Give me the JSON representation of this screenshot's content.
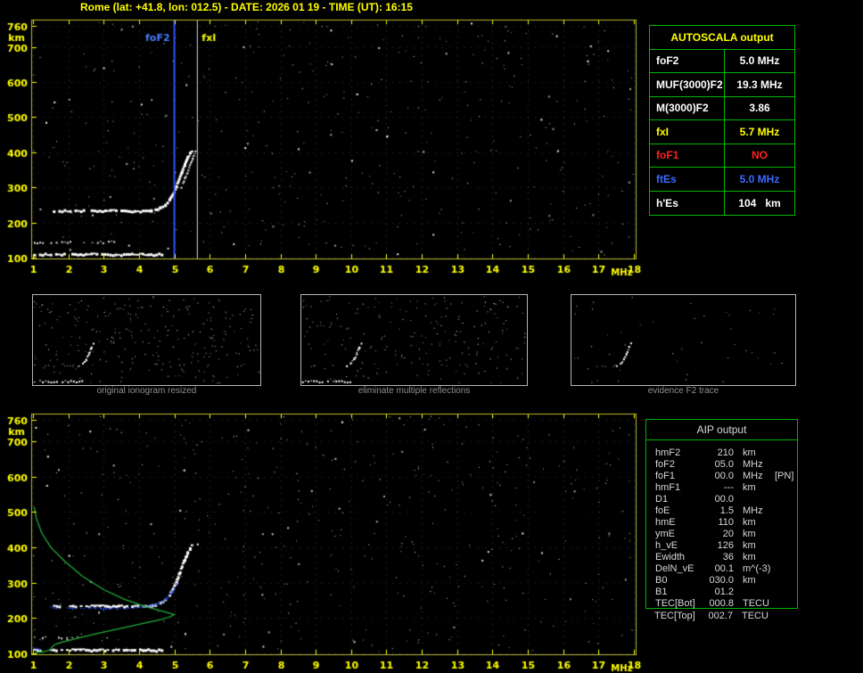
{
  "header": {
    "title": "Rome (lat: +41.8, lon: 012.5) - DATE: 2026 01 19 - TIME (UT): 16:15",
    "color": "#ffff00"
  },
  "autoscala": {
    "title": "AUTOSCALA output",
    "title_color": "#ffff00",
    "border_color": "#00b400",
    "rows": [
      {
        "label": "foF2",
        "value": "5.0 MHz",
        "color": "#ffffff"
      },
      {
        "label": "MUF(3000)F2",
        "value": "19.3 MHz",
        "color": "#ffffff"
      },
      {
        "label": "M(3000)F2",
        "value": "3.86",
        "color": "#ffffff"
      },
      {
        "label": "fxI",
        "value": "5.7 MHz",
        "color": "#ffff00"
      },
      {
        "label": "foF1",
        "value": "NO",
        "color": "#ff2020"
      },
      {
        "label": "ftEs",
        "value": "5.0 MHz",
        "color": "#3a6bff"
      },
      {
        "label": "h'Es",
        "value": "104   km",
        "color": "#ffffff"
      }
    ]
  },
  "thumbnails": [
    {
      "caption": "original ionogram resized"
    },
    {
      "caption": "eliminate multiple reflections"
    },
    {
      "caption": "evidence F2 trace"
    }
  ],
  "aip": {
    "title": "AIP output",
    "border_color": "#00b400",
    "text_color": "#d8d8d8",
    "rows": [
      {
        "name": "hmF2",
        "value": "210",
        "unit": "km",
        "extra": ""
      },
      {
        "name": "foF2",
        "value": "05.0",
        "unit": "MHz",
        "extra": ""
      },
      {
        "name": "foF1",
        "value": "00.0",
        "unit": "MHz",
        "extra": "[PN]"
      },
      {
        "name": "hmF1",
        "value": "---",
        "unit": "km",
        "extra": ""
      },
      {
        "name": "D1",
        "value": "00.0",
        "unit": "",
        "extra": ""
      },
      {
        "name": "foE",
        "value": "1.5",
        "unit": "MHz",
        "extra": ""
      },
      {
        "name": "hmE",
        "value": "110",
        "unit": "km",
        "extra": ""
      },
      {
        "name": "ymE",
        "value": "20",
        "unit": "km",
        "extra": ""
      },
      {
        "name": "h_vE",
        "value": "126",
        "unit": "km",
        "extra": ""
      },
      {
        "name": "Ewidth",
        "value": "36",
        "unit": "km",
        "extra": ""
      },
      {
        "name": "DelN_vE",
        "value": "00.1",
        "unit": "m^(-3)",
        "extra": ""
      },
      {
        "name": "B0",
        "value": "030.0",
        "unit": "km",
        "extra": ""
      },
      {
        "name": "B1",
        "value": "01.2",
        "unit": "",
        "extra": ""
      }
    ],
    "tec_rows": [
      {
        "name": "TEC[Bot]",
        "value": "000.8",
        "unit": "TECU"
      },
      {
        "name": "TEC[Top]",
        "value": "002.7",
        "unit": "TECU"
      }
    ]
  },
  "chart_data": [
    {
      "id": "top_ionogram",
      "render": "full",
      "type": "scatter",
      "title": "recorded ionogram with autoscaled characteristics",
      "xlabel": "MHz",
      "ylabel": "km",
      "xlim": [
        1,
        18
      ],
      "ylim": [
        100,
        760
      ],
      "x_ticks": [
        1,
        2,
        3,
        4,
        5,
        6,
        7,
        8,
        9,
        10,
        11,
        12,
        13,
        14,
        15,
        16,
        17,
        18
      ],
      "y_ticks": [
        760,
        700,
        600,
        500,
        400,
        300,
        200,
        100
      ],
      "axis_color": "#ffff00",
      "box_color": "#b9b931",
      "grid": "dotted",
      "noise": {
        "count": 400,
        "seed": 9
      },
      "markers": [
        {
          "name": "foF2",
          "f": 5.0,
          "line_color": "#3350ff",
          "label_color": "#4a7dff",
          "label_side": "left"
        },
        {
          "name": "fxI",
          "f": 5.65,
          "line_color": "#d8d8d8",
          "label_color": "#ffff00",
          "label_side": "right"
        }
      ],
      "traces": [
        {
          "name": "Es-layer-trace",
          "color": "#ffffff",
          "style": "speckle",
          "size": 3,
          "points": [
            [
              1.05,
              108
            ],
            [
              4.65,
              108
            ]
          ]
        },
        {
          "name": "Es-upper-echo",
          "color": "#e0e0e0",
          "style": "speckle-sparse",
          "size": 2,
          "points": [
            [
              1.05,
              143
            ],
            [
              3.3,
              143
            ]
          ]
        },
        {
          "name": "F2-flat-trace",
          "color": "#ffffff",
          "style": "speckle",
          "size": 3,
          "points": [
            [
              1.6,
              232
            ],
            [
              4.35,
              232
            ]
          ]
        },
        {
          "name": "F2-rising-trace",
          "color": "#ffffff",
          "style": "blobs",
          "size": 3,
          "points": [
            [
              4.35,
              233
            ],
            [
              4.6,
              240
            ],
            [
              4.75,
              250
            ],
            [
              4.87,
              263
            ],
            [
              4.97,
              280
            ],
            [
              5.06,
              300
            ],
            [
              5.14,
              322
            ],
            [
              5.22,
              345
            ],
            [
              5.3,
              365
            ],
            [
              5.38,
              383
            ],
            [
              5.45,
              395
            ],
            [
              5.5,
              403
            ]
          ]
        },
        {
          "name": "F2-x-mode-trace",
          "color": "#e8e8e8",
          "style": "blobs",
          "size": 2,
          "points": [
            [
              5.2,
              300
            ],
            [
              5.3,
              325
            ],
            [
              5.42,
              355
            ],
            [
              5.52,
              382
            ],
            [
              5.6,
              400
            ]
          ]
        }
      ]
    },
    {
      "id": "bottom_ionogram",
      "render": "full",
      "type": "scatter",
      "title": "ionogram with fitted trace and electron density profile",
      "xlabel": "MHz",
      "ylabel": "km",
      "xlim": [
        1,
        18
      ],
      "ylim": [
        100,
        760
      ],
      "x_ticks": [
        1,
        2,
        3,
        4,
        5,
        6,
        7,
        8,
        9,
        10,
        11,
        12,
        13,
        14,
        15,
        16,
        17,
        18
      ],
      "y_ticks": [
        760,
        700,
        600,
        500,
        400,
        300,
        200,
        100
      ],
      "axis_color": "#ffff00",
      "box_color": "#b9b931",
      "grid": "dotted",
      "noise": {
        "count": 430,
        "seed": 5
      },
      "markers": [],
      "traces": [
        {
          "name": "Es-layer-trace",
          "color": "#ffffff",
          "style": "speckle",
          "size": 3,
          "points": [
            [
              1.05,
              108
            ],
            [
              4.65,
              108
            ]
          ]
        },
        {
          "name": "Es-upper-echo",
          "color": "#e0e0e0",
          "style": "speckle-sparse",
          "size": 2,
          "points": [
            [
              1.05,
              143
            ],
            [
              3.1,
              143
            ]
          ]
        },
        {
          "name": "F2-flat-trace",
          "color": "#ffffff",
          "style": "speckle",
          "size": 3,
          "points": [
            [
              1.6,
              232
            ],
            [
              4.35,
              232
            ]
          ]
        },
        {
          "name": "F2-rising-trace",
          "color": "#ffffff",
          "style": "blobs",
          "size": 3,
          "points": [
            [
              4.35,
              233
            ],
            [
              4.6,
              240
            ],
            [
              4.75,
              250
            ],
            [
              4.87,
              263
            ],
            [
              4.97,
              280
            ],
            [
              5.06,
              300
            ],
            [
              5.14,
              322
            ],
            [
              5.22,
              345
            ],
            [
              5.3,
              365
            ],
            [
              5.38,
              383
            ],
            [
              5.45,
              395
            ],
            [
              5.5,
              403
            ]
          ]
        },
        {
          "name": "fitted-F2-trace",
          "color": "#2547e0",
          "style": "speckle",
          "size": 2,
          "points": [
            [
              1.5,
              229
            ],
            [
              2.2,
              226
            ],
            [
              3.0,
              225
            ],
            [
              3.7,
              227
            ],
            [
              4.2,
              231
            ],
            [
              4.5,
              238
            ],
            [
              4.75,
              252
            ],
            [
              4.95,
              275
            ],
            [
              5.05,
              295
            ]
          ]
        },
        {
          "name": "fitted-E-trace",
          "color": "#2547e0",
          "style": "speckle",
          "size": 2,
          "points": [
            [
              1.02,
              113
            ],
            [
              1.5,
              110
            ]
          ]
        },
        {
          "name": "electron-density-profile",
          "color": "#1fae3a",
          "style": "line",
          "size": 1,
          "points": [
            [
              1.03,
              515
            ],
            [
              1.1,
              480
            ],
            [
              1.25,
              440
            ],
            [
              1.5,
              400
            ],
            [
              1.9,
              360
            ],
            [
              2.4,
              318
            ],
            [
              3.0,
              280
            ],
            [
              3.6,
              252
            ],
            [
              4.2,
              232
            ],
            [
              4.7,
              218
            ],
            [
              5.0,
              210
            ],
            [
              4.85,
              202
            ],
            [
              4.5,
              193
            ],
            [
              4.0,
              182
            ],
            [
              3.4,
              169
            ],
            [
              2.8,
              156
            ],
            [
              2.3,
              144
            ],
            [
              1.9,
              134
            ],
            [
              1.7,
              128
            ],
            [
              1.6,
              124
            ],
            [
              1.52,
              116
            ],
            [
              1.5,
              110
            ],
            [
              1.3,
              105
            ],
            [
              1.05,
              101
            ]
          ]
        }
      ]
    },
    {
      "id": "thumb1",
      "render": "mini",
      "type": "scatter",
      "xlim": [
        1,
        18
      ],
      "ylim": [
        100,
        760
      ],
      "noise": {
        "count": 260,
        "seed": 21
      },
      "traces": [
        {
          "name": "es-trace",
          "color": "#ffffff",
          "style": "speckle",
          "size": 2,
          "points": [
            [
              1.05,
              112
            ],
            [
              4.65,
              112
            ]
          ]
        },
        {
          "name": "f2-flat",
          "color": "#c8c8c8",
          "style": "speckle-sparse",
          "size": 1,
          "points": [
            [
              1.7,
              232
            ],
            [
              4.35,
              232
            ]
          ]
        },
        {
          "name": "f2-rise",
          "color": "#ffffff",
          "style": "blobs",
          "size": 2,
          "points": [
            [
              4.4,
              235
            ],
            [
              4.7,
              250
            ],
            [
              4.95,
              280
            ],
            [
              5.15,
              325
            ],
            [
              5.35,
              372
            ],
            [
              5.5,
              402
            ]
          ]
        }
      ]
    },
    {
      "id": "thumb2",
      "render": "mini",
      "type": "scatter",
      "xlim": [
        1,
        18
      ],
      "ylim": [
        100,
        760
      ],
      "noise": {
        "count": 210,
        "seed": 22
      },
      "traces": [
        {
          "name": "es-trace",
          "color": "#ffffff",
          "style": "speckle",
          "size": 2,
          "points": [
            [
              1.05,
              112
            ],
            [
              4.65,
              112
            ]
          ]
        },
        {
          "name": "f2-flat",
          "color": "#c8c8c8",
          "style": "speckle-sparse",
          "size": 1,
          "points": [
            [
              1.7,
              232
            ],
            [
              4.35,
              232
            ]
          ]
        },
        {
          "name": "f2-rise",
          "color": "#ffffff",
          "style": "blobs",
          "size": 2,
          "points": [
            [
              4.4,
              235
            ],
            [
              4.7,
              250
            ],
            [
              4.95,
              280
            ],
            [
              5.15,
              325
            ],
            [
              5.35,
              372
            ],
            [
              5.5,
              402
            ]
          ]
        }
      ]
    },
    {
      "id": "thumb3",
      "render": "mini",
      "type": "scatter",
      "xlim": [
        1,
        18
      ],
      "ylim": [
        100,
        760
      ],
      "noise": {
        "count": 45,
        "seed": 23
      },
      "traces": [
        {
          "name": "f2-flat",
          "color": "#b8b8b8",
          "style": "speckle-sparse",
          "size": 1,
          "points": [
            [
              2.9,
              232
            ],
            [
              4.35,
              232
            ]
          ]
        },
        {
          "name": "f2-rise",
          "color": "#ffffff",
          "style": "blobs",
          "size": 2,
          "points": [
            [
              4.4,
              235
            ],
            [
              4.7,
              250
            ],
            [
              4.95,
              280
            ],
            [
              5.15,
              325
            ],
            [
              5.35,
              372
            ],
            [
              5.5,
              402
            ]
          ]
        }
      ]
    }
  ]
}
